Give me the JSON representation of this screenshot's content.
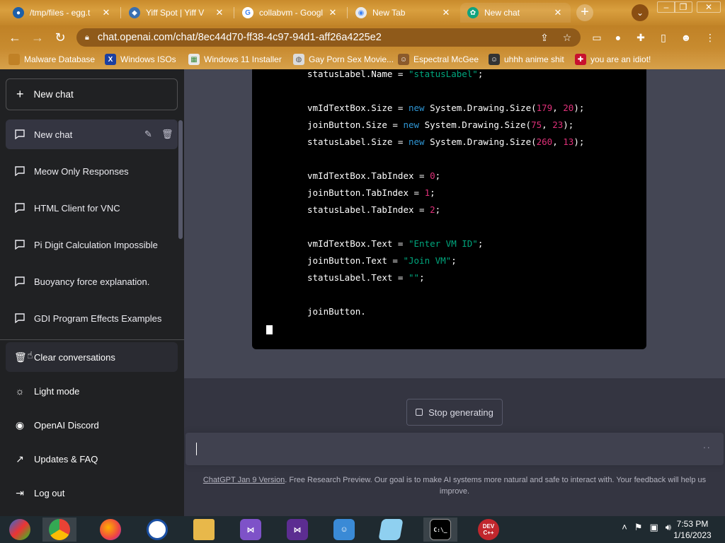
{
  "browser": {
    "tabs": [
      {
        "title": "/tmp/files - egg.t",
        "icon": "owncloud-icon"
      },
      {
        "title": "Yiff Spot | Yiff V",
        "icon": "site-icon"
      },
      {
        "title": "collabvm - Google",
        "icon": "google-icon"
      },
      {
        "title": "New Tab",
        "icon": "chrome-icon"
      },
      {
        "title": "New chat",
        "icon": "openai-icon"
      }
    ],
    "new_tab_symbol": "+",
    "url": "chat.openai.com/chat/8ec44d70-ff38-4c97-94d1-aff26a4225e2",
    "bookmarks": [
      {
        "label": "Malware Database",
        "icon": "folder-icon"
      },
      {
        "label": "Windows ISOs",
        "icon": "x-icon"
      },
      {
        "label": "Windows 11 Installer",
        "icon": "image-icon"
      },
      {
        "label": "Gay Porn Sex Movie...",
        "icon": "site-icon"
      },
      {
        "label": "Espectral McGee",
        "icon": "avatar-icon"
      },
      {
        "label": "uhhh anime shit",
        "icon": "avatar-icon"
      },
      {
        "label": "you are an idiot!",
        "icon": "flag-icon"
      }
    ]
  },
  "sidebar": {
    "new_chat_label": "New chat",
    "conversations": [
      {
        "label": "New chat",
        "selected": true
      },
      {
        "label": "Meow Only Responses"
      },
      {
        "label": "HTML Client for VNC"
      },
      {
        "label": "Pi Digit Calculation Impossible"
      },
      {
        "label": "Buoyancy force explanation."
      },
      {
        "label": "GDI Program Effects Examples"
      }
    ],
    "bottom_items": [
      {
        "label": "Clear conversations",
        "icon": "trash-icon"
      },
      {
        "label": "Light mode",
        "icon": "sun-icon"
      },
      {
        "label": "OpenAI Discord",
        "icon": "discord-icon"
      },
      {
        "label": "Updates & FAQ",
        "icon": "external-link-icon"
      },
      {
        "label": "Log out",
        "icon": "logout-icon"
      }
    ]
  },
  "code": {
    "lines": [
      {
        "tokens": [
          [
            "plain",
            "statusLabel.Name = "
          ],
          [
            "str",
            "\"statusLabel\""
          ],
          [
            "plain",
            ";"
          ]
        ]
      },
      {
        "tokens": [
          [
            "plain",
            "vmIdTextBox.Size = "
          ],
          [
            "kw",
            "new"
          ],
          [
            "plain",
            " System.Drawing.Size("
          ],
          [
            "num",
            "179"
          ],
          [
            "plain",
            ", "
          ],
          [
            "num",
            "20"
          ],
          [
            "plain",
            ");"
          ]
        ]
      },
      {
        "tokens": [
          [
            "plain",
            "joinButton.Size = "
          ],
          [
            "kw",
            "new"
          ],
          [
            "plain",
            " System.Drawing.Size("
          ],
          [
            "num",
            "75"
          ],
          [
            "plain",
            ", "
          ],
          [
            "num",
            "23"
          ],
          [
            "plain",
            ");"
          ]
        ]
      },
      {
        "tokens": [
          [
            "plain",
            "statusLabel.Size = "
          ],
          [
            "kw",
            "new"
          ],
          [
            "plain",
            " System.Drawing.Size("
          ],
          [
            "num",
            "260"
          ],
          [
            "plain",
            ", "
          ],
          [
            "num",
            "13"
          ],
          [
            "plain",
            ");"
          ]
        ]
      },
      {
        "tokens": [
          [
            "plain",
            "vmIdTextBox.TabIndex = "
          ],
          [
            "num",
            "0"
          ],
          [
            "plain",
            ";"
          ]
        ]
      },
      {
        "tokens": [
          [
            "plain",
            "joinButton.TabIndex = "
          ],
          [
            "num",
            "1"
          ],
          [
            "plain",
            ";"
          ]
        ]
      },
      {
        "tokens": [
          [
            "plain",
            "statusLabel.TabIndex = "
          ],
          [
            "num",
            "2"
          ],
          [
            "plain",
            ";"
          ]
        ]
      },
      {
        "tokens": [
          [
            "plain",
            "vmIdTextBox.Text = "
          ],
          [
            "str",
            "\"Enter VM ID\""
          ],
          [
            "plain",
            ";"
          ]
        ]
      },
      {
        "tokens": [
          [
            "plain",
            "joinButton.Text = "
          ],
          [
            "str",
            "\"Join VM\""
          ],
          [
            "plain",
            ";"
          ]
        ]
      },
      {
        "tokens": [
          [
            "plain",
            "statusLabel.Text = "
          ],
          [
            "str",
            "\"\""
          ],
          [
            "plain",
            ";"
          ]
        ]
      },
      {
        "tokens": [
          [
            "plain",
            "joinButton."
          ]
        ]
      }
    ]
  },
  "main": {
    "stop_label": "Stop generating",
    "footer_link": "ChatGPT Jan 9 Version",
    "footer_text": ". Free Research Preview. Our goal is to make AI systems more natural and safe to interact with. Your feedback will help us improve."
  },
  "taskbar": {
    "apps": [
      {
        "name": "control-panel",
        "glyph": ""
      },
      {
        "name": "chrome",
        "glyph": ""
      },
      {
        "name": "firefox",
        "glyph": ""
      },
      {
        "name": "obama",
        "glyph": ""
      },
      {
        "name": "file-explorer",
        "glyph": ""
      },
      {
        "name": "visual-studio-installer",
        "glyph": ""
      },
      {
        "name": "visual-studio",
        "glyph": ""
      },
      {
        "name": "network-users",
        "glyph": ""
      },
      {
        "name": "notepad",
        "glyph": ""
      },
      {
        "name": "command-prompt",
        "glyph": "C:\\_"
      },
      {
        "name": "dev-cpp",
        "glyph": "DEV C++"
      }
    ],
    "time": "7:53 PM",
    "date": "1/16/2023"
  },
  "colors": {
    "sidebar_bg": "#202123",
    "main_bg": "#343541",
    "code_bg": "#000000",
    "keyword": "#2e95d3",
    "number": "#df3079",
    "string": "#00a67d",
    "browser_theme": "#c98b2c"
  }
}
